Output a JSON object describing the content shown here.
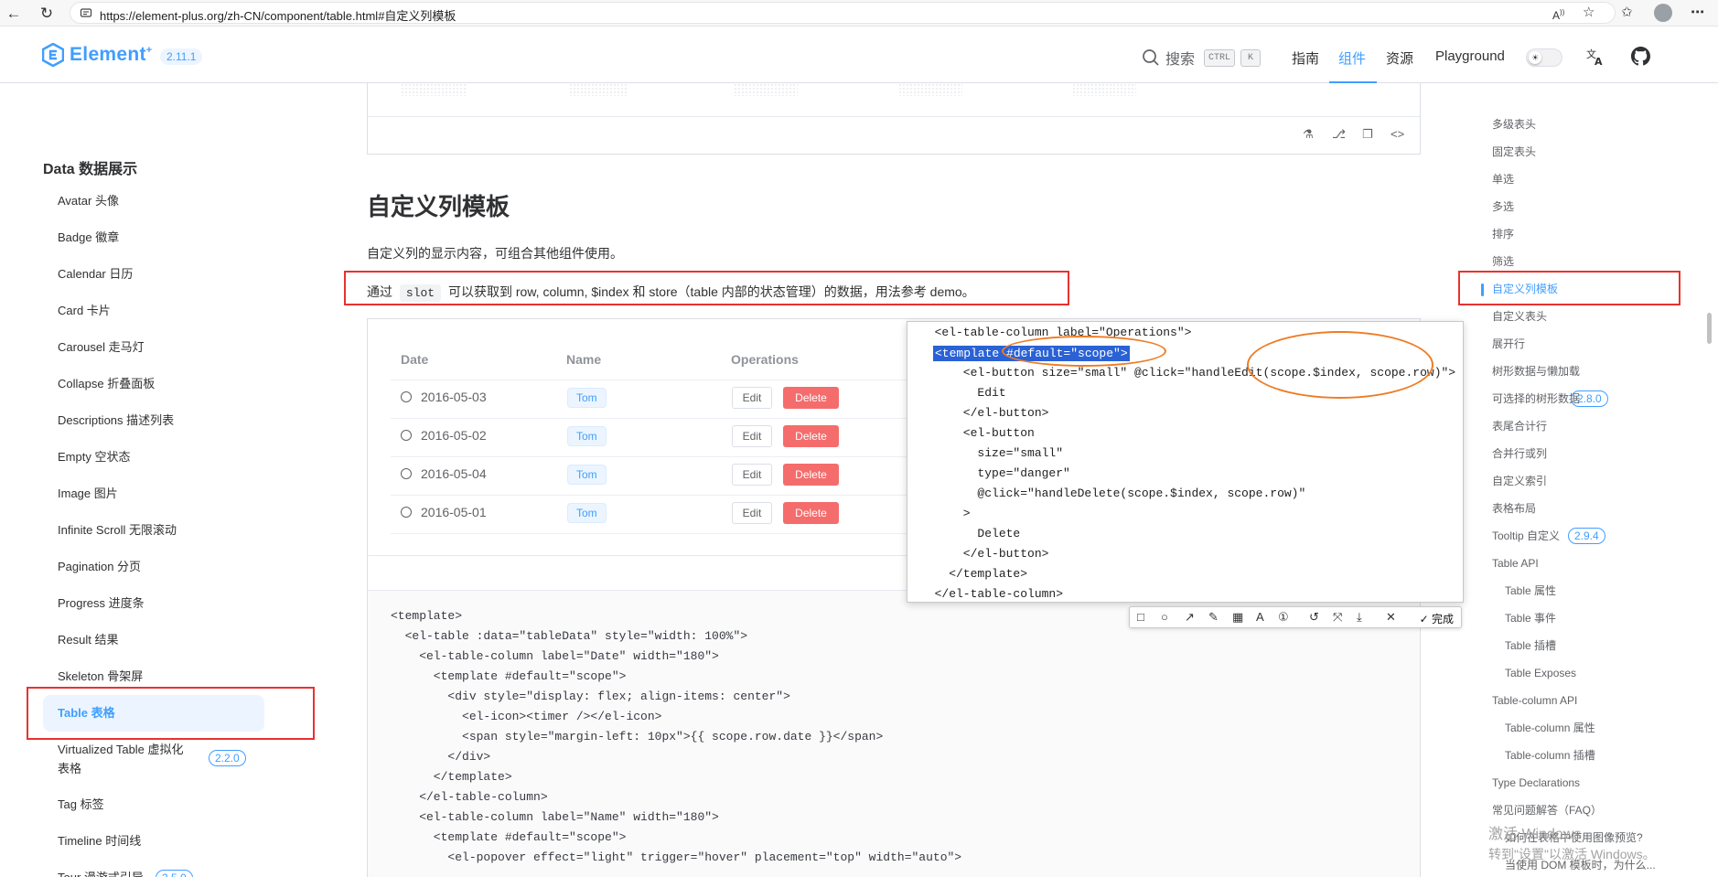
{
  "browser": {
    "url": "https://element-plus.org/zh-CN/component/table.html#自定义列模板"
  },
  "header": {
    "logo_text": "Element",
    "logo_sup": "+",
    "version": "2.11.1",
    "search_label": "搜索",
    "kbd_ctrl": "CTRL",
    "kbd_k": "K",
    "nav": [
      "指南",
      "组件",
      "资源",
      "Playground"
    ]
  },
  "sidebar": {
    "heading": "Data 数据展示",
    "items": [
      "Avatar 头像",
      "Badge 徽章",
      "Calendar 日历",
      "Card 卡片",
      "Carousel 走马灯",
      "Collapse 折叠面板",
      "Descriptions 描述列表",
      "Empty 空状态",
      "Image 图片",
      "Infinite Scroll 无限滚动",
      "Pagination 分页",
      "Progress 进度条",
      "Result 结果",
      "Skeleton 骨架屏",
      "Table 表格",
      "Virtualized Table 虚拟化",
      "表格",
      "Tag 标签",
      "Timeline 时间线",
      "Tour 漫游式引导"
    ],
    "virtualized_version": "2.2.0",
    "tour_version": "2.5.0"
  },
  "main": {
    "section_title": "自定义列模板",
    "para1": "自定义列的显示内容，可组合其他组件使用。",
    "para2_before": "通过",
    "para2_code": "slot",
    "para2_after": "可以获取到 row, column, $index 和 store（table 内部的状态管理）的数据，用法参考 demo。",
    "table": {
      "headers": [
        "Date",
        "Name",
        "Operations"
      ],
      "rows": [
        {
          "date": "2016-05-03",
          "name": "Tom"
        },
        {
          "date": "2016-05-02",
          "name": "Tom"
        },
        {
          "date": "2016-05-04",
          "name": "Tom"
        },
        {
          "date": "2016-05-01",
          "name": "Tom"
        }
      ],
      "edit_label": "Edit",
      "delete_label": "Delete"
    },
    "code_lines": [
      "<template>",
      "  <el-table :data=\"tableData\" style=\"width: 100%\">",
      "    <el-table-column label=\"Date\" width=\"180\">",
      "      <template #default=\"scope\">",
      "        <div style=\"display: flex; align-items: center\">",
      "          <el-icon><timer /></el-icon>",
      "          <span style=\"margin-left: 10px\">{{ scope.row.date }}</span>",
      "        </div>",
      "      </template>",
      "    </el-table-column>",
      "    <el-table-column label=\"Name\" width=\"180\">",
      "      <template #default=\"scope\">",
      "        <el-popover effect=\"light\" trigger=\"hover\" placement=\"top\" width=\"auto\">"
    ]
  },
  "popup": {
    "lines": [
      "  <el-table-column label=\"Operations\">",
      "    <template #default=\"scope\">",
      "      <el-button size=\"small\" @click=\"handleEdit(scope.$index, scope.row)\">",
      "        Edit",
      "      </el-button>",
      "      <el-button",
      "        size=\"small\"",
      "        type=\"danger\"",
      "        @click=\"handleDelete(scope.$index, scope.row)\"",
      "      >",
      "        Delete",
      "      </el-button>",
      "    </template>",
      "  </el-table-column>"
    ],
    "highlight_text": "<template #default=\"scope\">",
    "done_label": "完成"
  },
  "toc": {
    "items": [
      "多级表头",
      "固定表头",
      "单选",
      "多选",
      "排序",
      "筛选",
      "自定义列模板",
      "自定义表头",
      "展开行",
      "树形数据与懒加载",
      "可选择的树形数据",
      "表尾合计行",
      "合并行或列",
      "自定义索引",
      "表格布局",
      "Tooltip 自定义",
      "Table API",
      "Table 属性",
      "Table 事件",
      "Table 插槽",
      "Table Exposes",
      "Table-column API",
      "Table-column 属性",
      "Table-column 插槽",
      "Type Declarations",
      "常见问题解答（FAQ）",
      "如何在表格中使用图像预览?",
      "当使用 DOM 模板时，为什么..."
    ],
    "tree_version": "2.8.0",
    "tooltip_version": "2.9.4"
  },
  "watermark": {
    "line1": "激活 Windows",
    "line2": "转到\"设置\"以激活 Windows。"
  },
  "colors": {
    "accent": "#409eff",
    "danger": "#f56c6c",
    "annotation_red": "#e8322f",
    "annotation_orange": "#ee7c25"
  }
}
